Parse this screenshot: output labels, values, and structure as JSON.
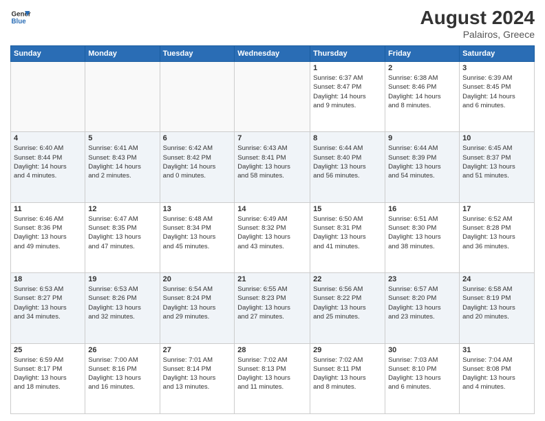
{
  "header": {
    "logo_line1": "General",
    "logo_line2": "Blue",
    "month_year": "August 2024",
    "location": "Palairos, Greece"
  },
  "days_of_week": [
    "Sunday",
    "Monday",
    "Tuesday",
    "Wednesday",
    "Thursday",
    "Friday",
    "Saturday"
  ],
  "weeks": [
    [
      {
        "num": "",
        "info": ""
      },
      {
        "num": "",
        "info": ""
      },
      {
        "num": "",
        "info": ""
      },
      {
        "num": "",
        "info": ""
      },
      {
        "num": "1",
        "info": "Sunrise: 6:37 AM\nSunset: 8:47 PM\nDaylight: 14 hours\nand 9 minutes."
      },
      {
        "num": "2",
        "info": "Sunrise: 6:38 AM\nSunset: 8:46 PM\nDaylight: 14 hours\nand 8 minutes."
      },
      {
        "num": "3",
        "info": "Sunrise: 6:39 AM\nSunset: 8:45 PM\nDaylight: 14 hours\nand 6 minutes."
      }
    ],
    [
      {
        "num": "4",
        "info": "Sunrise: 6:40 AM\nSunset: 8:44 PM\nDaylight: 14 hours\nand 4 minutes."
      },
      {
        "num": "5",
        "info": "Sunrise: 6:41 AM\nSunset: 8:43 PM\nDaylight: 14 hours\nand 2 minutes."
      },
      {
        "num": "6",
        "info": "Sunrise: 6:42 AM\nSunset: 8:42 PM\nDaylight: 14 hours\nand 0 minutes."
      },
      {
        "num": "7",
        "info": "Sunrise: 6:43 AM\nSunset: 8:41 PM\nDaylight: 13 hours\nand 58 minutes."
      },
      {
        "num": "8",
        "info": "Sunrise: 6:44 AM\nSunset: 8:40 PM\nDaylight: 13 hours\nand 56 minutes."
      },
      {
        "num": "9",
        "info": "Sunrise: 6:44 AM\nSunset: 8:39 PM\nDaylight: 13 hours\nand 54 minutes."
      },
      {
        "num": "10",
        "info": "Sunrise: 6:45 AM\nSunset: 8:37 PM\nDaylight: 13 hours\nand 51 minutes."
      }
    ],
    [
      {
        "num": "11",
        "info": "Sunrise: 6:46 AM\nSunset: 8:36 PM\nDaylight: 13 hours\nand 49 minutes."
      },
      {
        "num": "12",
        "info": "Sunrise: 6:47 AM\nSunset: 8:35 PM\nDaylight: 13 hours\nand 47 minutes."
      },
      {
        "num": "13",
        "info": "Sunrise: 6:48 AM\nSunset: 8:34 PM\nDaylight: 13 hours\nand 45 minutes."
      },
      {
        "num": "14",
        "info": "Sunrise: 6:49 AM\nSunset: 8:32 PM\nDaylight: 13 hours\nand 43 minutes."
      },
      {
        "num": "15",
        "info": "Sunrise: 6:50 AM\nSunset: 8:31 PM\nDaylight: 13 hours\nand 41 minutes."
      },
      {
        "num": "16",
        "info": "Sunrise: 6:51 AM\nSunset: 8:30 PM\nDaylight: 13 hours\nand 38 minutes."
      },
      {
        "num": "17",
        "info": "Sunrise: 6:52 AM\nSunset: 8:28 PM\nDaylight: 13 hours\nand 36 minutes."
      }
    ],
    [
      {
        "num": "18",
        "info": "Sunrise: 6:53 AM\nSunset: 8:27 PM\nDaylight: 13 hours\nand 34 minutes."
      },
      {
        "num": "19",
        "info": "Sunrise: 6:53 AM\nSunset: 8:26 PM\nDaylight: 13 hours\nand 32 minutes."
      },
      {
        "num": "20",
        "info": "Sunrise: 6:54 AM\nSunset: 8:24 PM\nDaylight: 13 hours\nand 29 minutes."
      },
      {
        "num": "21",
        "info": "Sunrise: 6:55 AM\nSunset: 8:23 PM\nDaylight: 13 hours\nand 27 minutes."
      },
      {
        "num": "22",
        "info": "Sunrise: 6:56 AM\nSunset: 8:22 PM\nDaylight: 13 hours\nand 25 minutes."
      },
      {
        "num": "23",
        "info": "Sunrise: 6:57 AM\nSunset: 8:20 PM\nDaylight: 13 hours\nand 23 minutes."
      },
      {
        "num": "24",
        "info": "Sunrise: 6:58 AM\nSunset: 8:19 PM\nDaylight: 13 hours\nand 20 minutes."
      }
    ],
    [
      {
        "num": "25",
        "info": "Sunrise: 6:59 AM\nSunset: 8:17 PM\nDaylight: 13 hours\nand 18 minutes."
      },
      {
        "num": "26",
        "info": "Sunrise: 7:00 AM\nSunset: 8:16 PM\nDaylight: 13 hours\nand 16 minutes."
      },
      {
        "num": "27",
        "info": "Sunrise: 7:01 AM\nSunset: 8:14 PM\nDaylight: 13 hours\nand 13 minutes."
      },
      {
        "num": "28",
        "info": "Sunrise: 7:02 AM\nSunset: 8:13 PM\nDaylight: 13 hours\nand 11 minutes."
      },
      {
        "num": "29",
        "info": "Sunrise: 7:02 AM\nSunset: 8:11 PM\nDaylight: 13 hours\nand 8 minutes."
      },
      {
        "num": "30",
        "info": "Sunrise: 7:03 AM\nSunset: 8:10 PM\nDaylight: 13 hours\nand 6 minutes."
      },
      {
        "num": "31",
        "info": "Sunrise: 7:04 AM\nSunset: 8:08 PM\nDaylight: 13 hours\nand 4 minutes."
      }
    ]
  ]
}
